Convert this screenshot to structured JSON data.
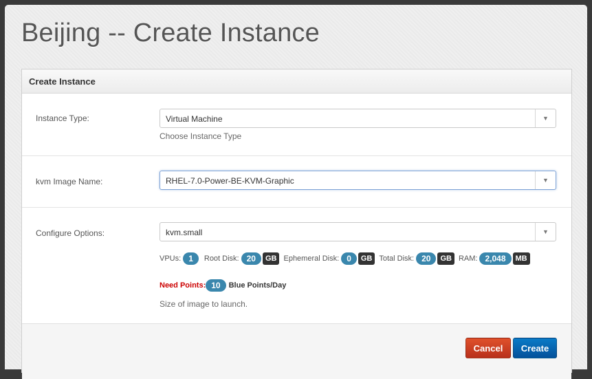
{
  "page": {
    "title": "Beijing -- Create Instance"
  },
  "panel": {
    "title": "Create Instance"
  },
  "instance_type": {
    "label": "Instance Type:",
    "value": "Virtual Machine",
    "hint": "Choose Instance Type"
  },
  "image": {
    "label": "kvm Image Name:",
    "value": "RHEL-7.0-Power-BE-KVM-Graphic"
  },
  "configure": {
    "label": "Configure Options:",
    "value": "kvm.small",
    "specs": {
      "vpus_label": "VPUs:",
      "vpus": "1",
      "root_label": "Root Disk:",
      "root": "20",
      "root_unit": "GB",
      "eph_label": "Ephemeral Disk:",
      "eph": "0",
      "eph_unit": "GB",
      "total_label": "Total Disk:",
      "total": "20",
      "total_unit": "GB",
      "ram_label": "RAM:",
      "ram": "2,048",
      "ram_unit": "MB"
    },
    "need_label": "Need Points:",
    "points": "10",
    "points_unit": "Blue Points/Day",
    "hint": "Size of image to launch."
  },
  "buttons": {
    "cancel": "Cancel",
    "create": "Create"
  },
  "colors": {
    "accent_blue": "#3a87ad",
    "cancel": "#c8401f",
    "create": "#0866b3",
    "need": "#cc0000"
  }
}
